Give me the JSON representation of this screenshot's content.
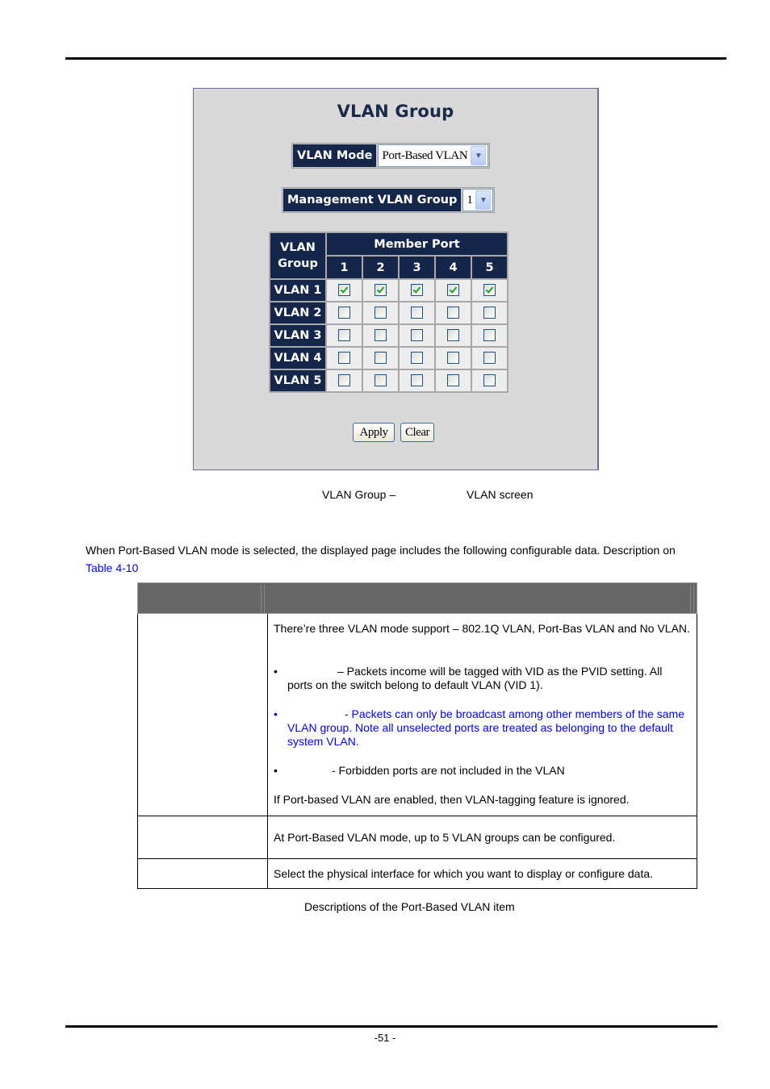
{
  "panel": {
    "title": "VLAN Group",
    "vlan_mode_label": "VLAN Mode",
    "vlan_mode_value": "Port-Based VLAN",
    "mgmt_label": "Management VLAN Group",
    "mgmt_value": "1",
    "table": {
      "group_header_line1": "VLAN",
      "group_header_line2": "Group",
      "member_header": "Member Port",
      "ports": [
        "1",
        "2",
        "3",
        "4",
        "5"
      ],
      "rows": [
        {
          "label": "VLAN 1",
          "members": [
            true,
            true,
            true,
            true,
            true
          ]
        },
        {
          "label": "VLAN 2",
          "members": [
            false,
            false,
            false,
            false,
            false
          ]
        },
        {
          "label": "VLAN 3",
          "members": [
            false,
            false,
            false,
            false,
            false
          ]
        },
        {
          "label": "VLAN 4",
          "members": [
            false,
            false,
            false,
            false,
            false
          ]
        },
        {
          "label": "VLAN 5",
          "members": [
            false,
            false,
            false,
            false,
            false
          ]
        }
      ]
    },
    "apply_label": "Apply",
    "clear_label": "Clear"
  },
  "figure_caption": {
    "part1": "VLAN Group –",
    "part2": "VLAN screen"
  },
  "intro": {
    "text": "When Port-Based VLAN mode is selected, the displayed page includes the following configurable data. Description on",
    "link": "Table 4-10"
  },
  "desc_table": {
    "row1": {
      "intro": "There’re three VLAN mode support – 802.1Q VLAN, Port-Bas VLAN and No VLAN.",
      "bullet1": "– Packets income will be tagged with VID as the PVID setting. All ports on the switch belong to default VLAN (VID 1).",
      "bullet2": "- Packets can only be broadcast among other members of the same VLAN group. Note all unselected ports are treated as belonging to the default system VLAN.",
      "bullet3": "- Forbidden ports are not included in the VLAN",
      "footer": "If Port-based VLAN are enabled, then VLAN-tagging feature is ignored."
    },
    "row2": "At Port-Based VLAN mode, up to 5 VLAN groups can be configured.",
    "row3": "Select the physical interface for which you want to display or configure data."
  },
  "table_caption": "Descriptions of the Port-Based VLAN item",
  "page_number": "-51 -",
  "colors": {
    "header_navy": "#14264a",
    "panel_bg": "#d9d9d9",
    "link_blue": "#0000ff",
    "desc_header_gray": "#666666",
    "check_green": "#21a121"
  }
}
